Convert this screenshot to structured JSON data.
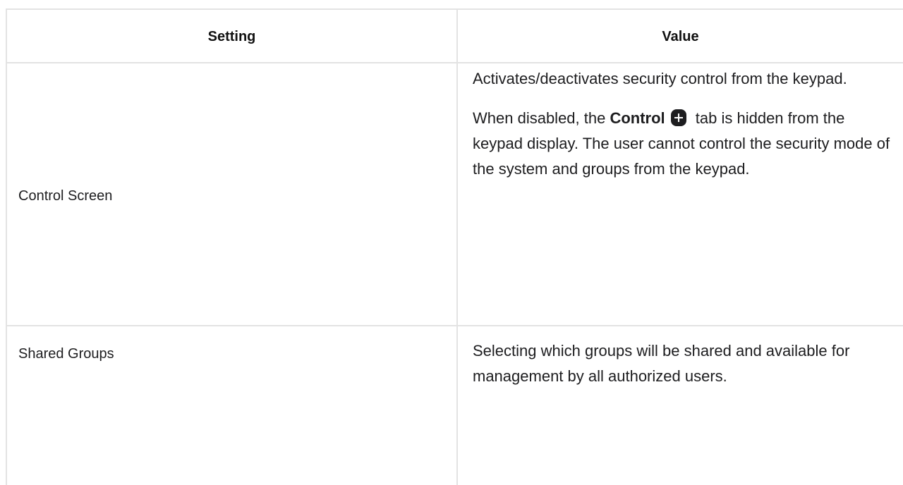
{
  "table": {
    "headers": {
      "setting": "Setting",
      "value": "Value"
    },
    "rows": [
      {
        "setting": "Control Screen",
        "value_paragraph_1": "Activates/deactivates security control from the keypad.",
        "value_paragraph_2_before": "When disabled, the ",
        "value_paragraph_2_bold": "Control",
        "value_paragraph_2_icon": "plus-icon",
        "value_paragraph_2_after": " tab is hidden from the keypad display. The user cannot control the security mode of the system and groups from the keypad."
      },
      {
        "setting": "Shared Groups",
        "value_paragraph_1": "Selecting which groups will be shared and available for management by all authorized users."
      }
    ]
  }
}
